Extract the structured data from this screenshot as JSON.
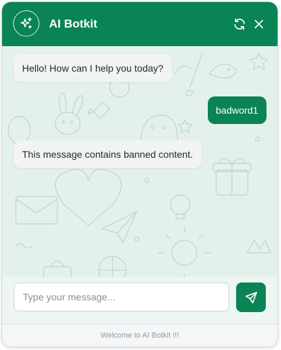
{
  "header": {
    "title": "AI Botkit",
    "avatar_icon": "sparkles-icon",
    "refresh_icon": "refresh-icon",
    "close_icon": "close-icon"
  },
  "messages": [
    {
      "role": "bot",
      "text": "Hello! How can I help you today?"
    },
    {
      "role": "user",
      "text": "badword1"
    },
    {
      "role": "bot",
      "text": "This message contains banned content."
    }
  ],
  "input": {
    "placeholder": "Type your message...",
    "value": "",
    "send_icon": "send-icon"
  },
  "footer": {
    "text": "Welcome to AI Botkit !!!"
  },
  "colors": {
    "brand": "#0a8454",
    "chat_background": "#e4f1eb",
    "bot_bubble": "#f2f4f3",
    "footer_text": "#8d9aa6"
  }
}
